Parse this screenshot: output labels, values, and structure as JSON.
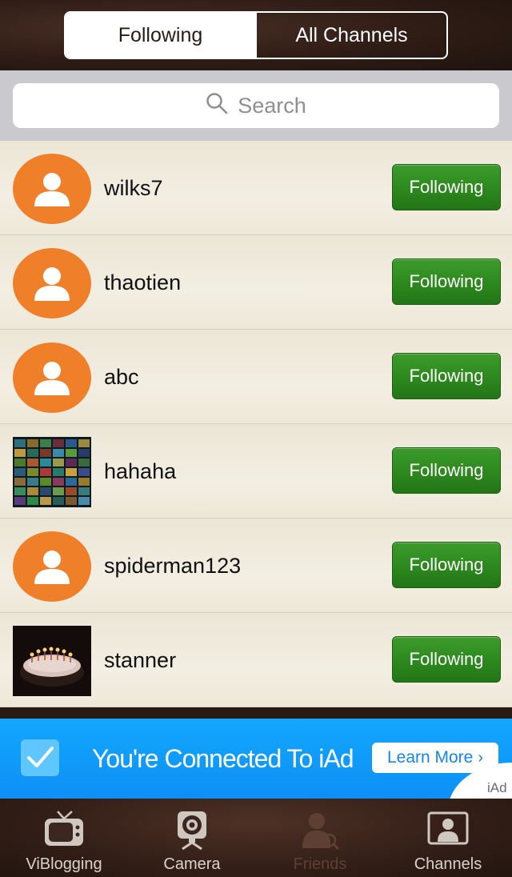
{
  "header": {
    "segments": [
      {
        "label": "Following",
        "active": true
      },
      {
        "label": "All Channels",
        "active": false
      }
    ]
  },
  "search": {
    "placeholder": "Search"
  },
  "rows": [
    {
      "username": "wilks7",
      "button": "Following",
      "avatar": "default-user-icon"
    },
    {
      "username": "thaotien",
      "button": "Following",
      "avatar": "default-user-icon"
    },
    {
      "username": "abc",
      "button": "Following",
      "avatar": "default-user-icon"
    },
    {
      "username": "hahaha",
      "button": "Following",
      "avatar": "photo-grid-thumbnail"
    },
    {
      "username": "spiderman123",
      "button": "Following",
      "avatar": "default-user-icon"
    },
    {
      "username": "stanner",
      "button": "Following",
      "avatar": "birthday-cake-photo"
    }
  ],
  "ad": {
    "text": "You're Connected To iAd",
    "button": "Learn More",
    "label": "iAd"
  },
  "tabbar": {
    "tabs": [
      {
        "label": "ViBlogging",
        "icon": "tv-icon"
      },
      {
        "label": "Camera",
        "icon": "camera-icon"
      },
      {
        "label": "Friends",
        "icon": "friends-search-icon",
        "active": true
      },
      {
        "label": "Channels",
        "icon": "channels-icon"
      }
    ]
  },
  "colors": {
    "accent_green": "#2e8a1e",
    "avatar_orange": "#f07f2a",
    "ad_blue": "#12a7ff"
  }
}
